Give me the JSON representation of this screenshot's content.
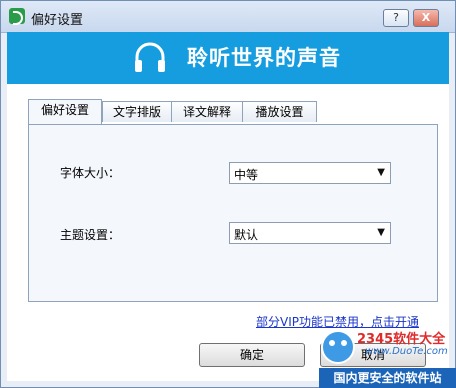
{
  "window": {
    "title": "偏好设置",
    "help": "?",
    "close": "X"
  },
  "banner": {
    "slogan": "聆听世界的声音",
    "icon": "headphones-icon",
    "color": "#159ddf"
  },
  "tabs": [
    {
      "label": "偏好设置",
      "active": true
    },
    {
      "label": "文字排版"
    },
    {
      "label": "译文解释"
    },
    {
      "label": "播放设置"
    }
  ],
  "settings": {
    "font_size": {
      "label": "字体大小：",
      "value": "中等"
    },
    "theme": {
      "label": "主题设置：",
      "value": "默认"
    }
  },
  "vip": {
    "text": "部分VIP功能已禁用，点击开通"
  },
  "buttons": {
    "ok": "确定",
    "cancel": "取消"
  },
  "watermark": {
    "brand": "2345软件大全",
    "url": "www.DuoTe.com",
    "bar": "国内更安全的软件站"
  }
}
